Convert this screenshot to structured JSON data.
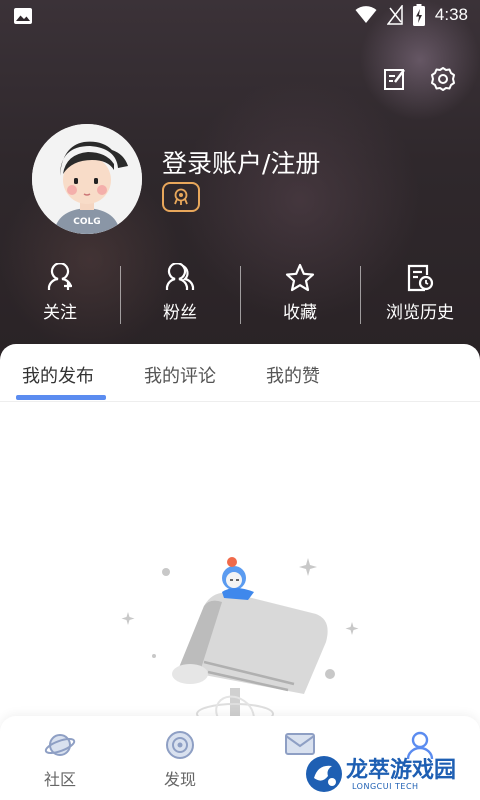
{
  "status_bar": {
    "time": "4:38"
  },
  "profile": {
    "username": "登录账户/注册"
  },
  "stats": [
    {
      "label": "关注",
      "icon": "user-plus-icon"
    },
    {
      "label": "粉丝",
      "icon": "users-icon"
    },
    {
      "label": "收藏",
      "icon": "star-icon"
    },
    {
      "label": "浏览历史",
      "icon": "history-icon"
    }
  ],
  "tabs": [
    {
      "label": "我的发布"
    },
    {
      "label": "我的评论"
    },
    {
      "label": "我的赞"
    }
  ],
  "bottom_nav": [
    {
      "label": "社区",
      "icon": "planet-icon"
    },
    {
      "label": "发现",
      "icon": "discover-icon"
    },
    {
      "label": "",
      "icon": "message-icon"
    },
    {
      "label": "",
      "icon": "profile-icon"
    }
  ],
  "watermark": {
    "text": "龙萃游戏园",
    "sub": "LONGCUI TECH"
  },
  "colors": {
    "accent": "#5b8cf0",
    "badge": "#e8a75b",
    "watermark": "#1e5fb3"
  }
}
